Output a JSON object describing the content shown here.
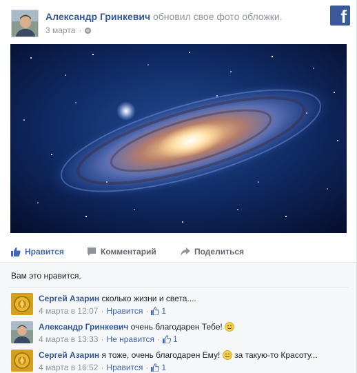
{
  "post": {
    "author_name": "Александр Гринкевич",
    "action_text": "обновил свое фото обложки.",
    "date": "3 марта",
    "privacy_icon": "globe-icon",
    "brand_icon": "facebook-logo",
    "brand_color": "#3b5998"
  },
  "actions": {
    "like_label": "Нравится",
    "comment_label": "Комментарий",
    "share_label": "Поделиться",
    "like_color": "#4267b2"
  },
  "likes": {
    "summary": "Вам это нравится."
  },
  "comments": [
    {
      "author": "Сергей Азарин",
      "text": "сколько жизни и света....",
      "timestamp": "4 марта в 12:07",
      "like_link": "Нравится",
      "like_count": "1"
    },
    {
      "author": "Александр Гринкевич",
      "text": "очень благодарен Тебе!",
      "timestamp": "4 марта в 13:33",
      "like_link": "Не нравится",
      "like_count": "1"
    },
    {
      "author": "Сергей Азарин",
      "text_before": "я тоже, очень благодарен Ему!",
      "text_after": "за такую-то Красоту...",
      "timestamp": "4 марта в 16:52",
      "like_link": "Нравится",
      "like_count": "1"
    }
  ],
  "separator": "·"
}
